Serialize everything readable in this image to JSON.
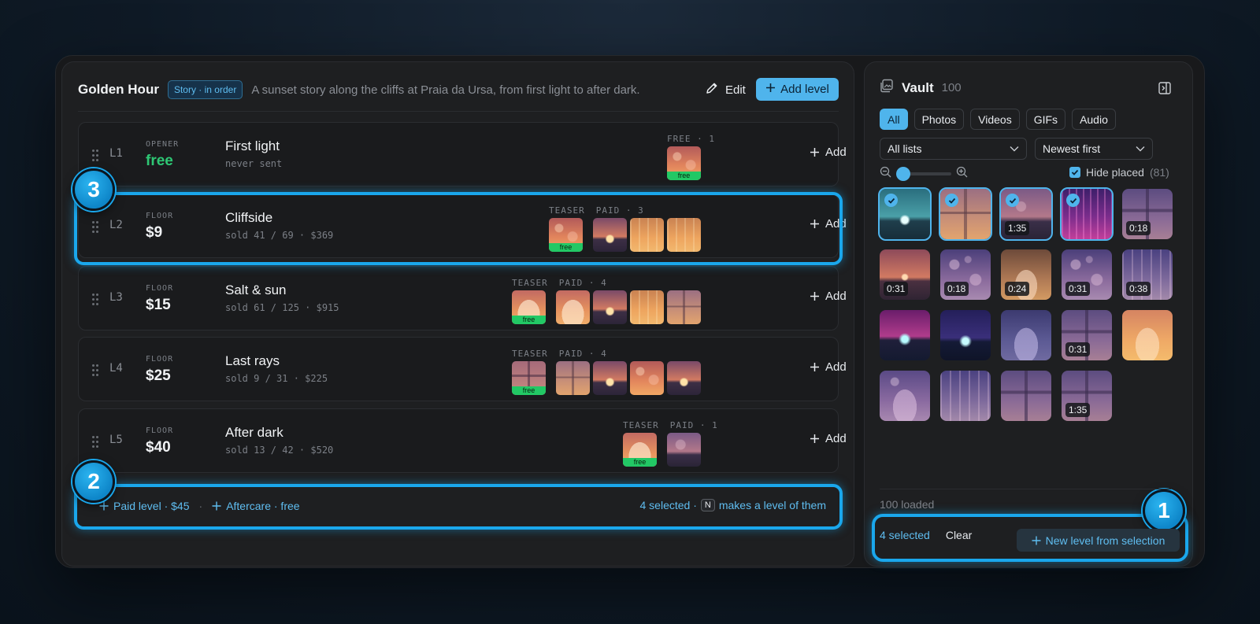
{
  "header": {
    "title": "Golden Hour",
    "tag": "Story · in order",
    "description": "A sunset story along the cliffs at Praia da Ursa, from first light to after dark.",
    "edit_label": "Edit",
    "add_level_label": "Add level"
  },
  "levels": [
    {
      "code": "L1",
      "kind": "OPENER",
      "price": "free",
      "name": "First light",
      "stats": "never sent",
      "labels": [
        "FREE · 1"
      ],
      "add_label": "Add",
      "thumbs": [
        {
          "bg": "sunset-orbs",
          "teaser": true,
          "badge": "free"
        }
      ]
    },
    {
      "code": "L2",
      "kind": "FLOOR",
      "price": "$9",
      "name": "Cliffside",
      "stats": "sold 41 / 69 · $369",
      "labels": [
        "TEASER",
        "PAID · 3"
      ],
      "add_label": "Add",
      "thumbs": [
        {
          "bg": "sunset-orbs",
          "teaser": true,
          "badge": "free"
        },
        {
          "bg": "sea-sun"
        },
        {
          "bg": "gold-rays"
        },
        {
          "bg": "gold-rays"
        }
      ]
    },
    {
      "code": "L3",
      "kind": "FLOOR",
      "price": "$15",
      "name": "Salt & sun",
      "stats": "sold 61 / 125 · $915",
      "labels": [
        "TEASER",
        "PAID · 4"
      ],
      "add_label": "Add",
      "thumbs": [
        {
          "bg": "arch-warm",
          "teaser": true,
          "badge": "free"
        },
        {
          "bg": "arch-warm"
        },
        {
          "bg": "sea-sun"
        },
        {
          "bg": "gold-rays"
        },
        {
          "bg": "window-warm"
        }
      ]
    },
    {
      "code": "L4",
      "kind": "FLOOR",
      "price": "$25",
      "name": "Last rays",
      "stats": "sold 9 / 31 · $225",
      "labels": [
        "TEASER",
        "PAID · 4"
      ],
      "add_label": "Add",
      "thumbs": [
        {
          "bg": "window-pink",
          "teaser": true,
          "badge": "free"
        },
        {
          "bg": "window-warm"
        },
        {
          "bg": "sea-sun"
        },
        {
          "bg": "sunset-orbs"
        },
        {
          "bg": "sea-sun"
        }
      ]
    },
    {
      "code": "L5",
      "kind": "FLOOR",
      "price": "$40",
      "name": "After dark",
      "stats": "sold 13 / 42 · $520",
      "labels": [
        "TEASER",
        "PAID · 1"
      ],
      "add_label": "Add",
      "thumbs": [
        {
          "bg": "arch-warm",
          "teaser": true,
          "badge": "free"
        },
        {
          "bg": "dusk-sea"
        }
      ]
    }
  ],
  "footer": {
    "paid_level": "Paid level · $45",
    "aftercare": "Aftercare · free",
    "selected_prefix": "4 selected ·",
    "kbd": "N",
    "selected_suffix": "makes a level of them"
  },
  "markers": {
    "one": "1",
    "two": "2",
    "three": "3"
  },
  "vault": {
    "title": "Vault",
    "count": "100",
    "filters": [
      {
        "label": "All",
        "active": true
      },
      {
        "label": "Photos",
        "active": false
      },
      {
        "label": "Videos",
        "active": false
      },
      {
        "label": "GIFs",
        "active": false
      },
      {
        "label": "Audio",
        "active": false
      }
    ],
    "list_select": "All lists",
    "sort_select": "Newest first",
    "zoom_level": 0.0,
    "hide_placed_label": "Hide placed",
    "hide_placed_count": "(81)",
    "hide_placed_checked": true,
    "tiles": [
      {
        "bg": "teal-sea",
        "selected": true,
        "duration": ""
      },
      {
        "bg": "window-warm",
        "selected": true,
        "duration": ""
      },
      {
        "bg": "dusk-sea",
        "selected": true,
        "duration": "1:35"
      },
      {
        "bg": "violet-rays",
        "selected": true,
        "duration": ""
      },
      {
        "bg": "window-violet",
        "selected": false,
        "duration": "0:18"
      },
      {
        "bg": "sunset-sea",
        "selected": false,
        "duration": "0:31"
      },
      {
        "bg": "violet-orbs",
        "selected": false,
        "duration": "0:18"
      },
      {
        "bg": "arch-brown",
        "selected": false,
        "duration": "0:24"
      },
      {
        "bg": "violet-orbs",
        "selected": false,
        "duration": "0:31"
      },
      {
        "bg": "violet-rays-soft",
        "selected": false,
        "duration": "0:38"
      },
      {
        "bg": "magenta-sea",
        "selected": false,
        "duration": ""
      },
      {
        "bg": "night-sea",
        "selected": false,
        "duration": ""
      },
      {
        "bg": "arch-violet",
        "selected": false,
        "duration": ""
      },
      {
        "bg": "window-violet",
        "selected": false,
        "duration": "0:31"
      },
      {
        "bg": "arch-gold",
        "selected": false,
        "duration": ""
      },
      {
        "bg": "arch-violet-orbs",
        "selected": false,
        "duration": ""
      },
      {
        "bg": "violet-rays-soft",
        "selected": false,
        "duration": ""
      },
      {
        "bg": "window-violet",
        "selected": false,
        "duration": ""
      },
      {
        "bg": "window-violet",
        "selected": false,
        "duration": "1:35"
      }
    ],
    "loaded": "100 loaded",
    "selected": "4 selected",
    "clear": "Clear",
    "new_level": "New level from selection"
  },
  "colors": {
    "accent": "#4fb4ec",
    "free_green": "#22c865",
    "highlight": "#1aa7ec"
  }
}
